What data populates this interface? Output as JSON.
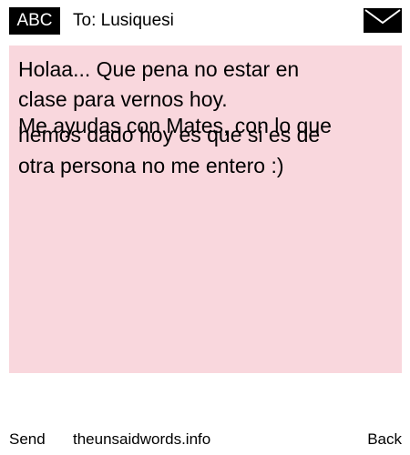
{
  "header": {
    "badge_label": "ABC",
    "recipient": "To: Lusiquesi",
    "icon": "envelope-icon"
  },
  "note": {
    "background": "#f9d7dd",
    "lines": [
      "Holaa... Que pena no estar en",
      "clase para vernos hoy.",
      "Me ayudas con Mates, con lo que",
      "hemos dado hoy es que si es de",
      "otra persona no me entero :)"
    ]
  },
  "footer": {
    "send_label": "Send",
    "site_label": "theunsaidwords.info",
    "back_label": "Back"
  }
}
